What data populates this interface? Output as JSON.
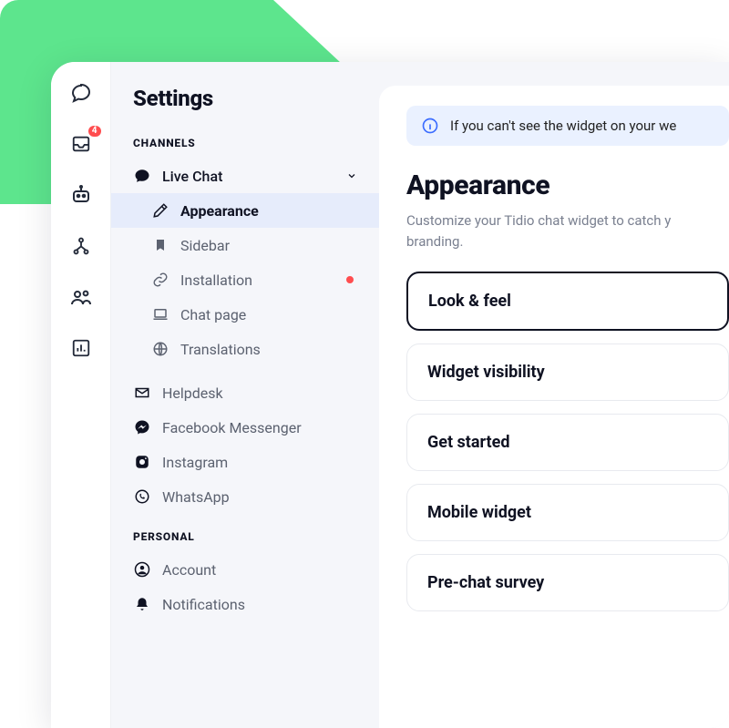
{
  "rail": {
    "badge": "4"
  },
  "sidebar": {
    "title": "Settings",
    "groups": {
      "channels": {
        "label": "CHANNELS",
        "live_chat": "Live Chat",
        "appearance": "Appearance",
        "sidebar": "Sidebar",
        "installation": "Installation",
        "chat_page": "Chat page",
        "translations": "Translations",
        "helpdesk": "Helpdesk",
        "facebook": "Facebook Messenger",
        "instagram": "Instagram",
        "whatsapp": "WhatsApp"
      },
      "personal": {
        "label": "PERSONAL",
        "account": "Account",
        "notifications": "Notifications"
      }
    }
  },
  "content": {
    "alert": "If you can't see the widget on your we",
    "heading": "Appearance",
    "description": "Customize your Tidio chat widget to catch y branding.",
    "cards": {
      "look_feel": "Look & feel",
      "widget_visibility": "Widget visibility",
      "get_started": "Get started",
      "mobile_widget": "Mobile widget",
      "pre_chat": "Pre-chat survey"
    }
  }
}
